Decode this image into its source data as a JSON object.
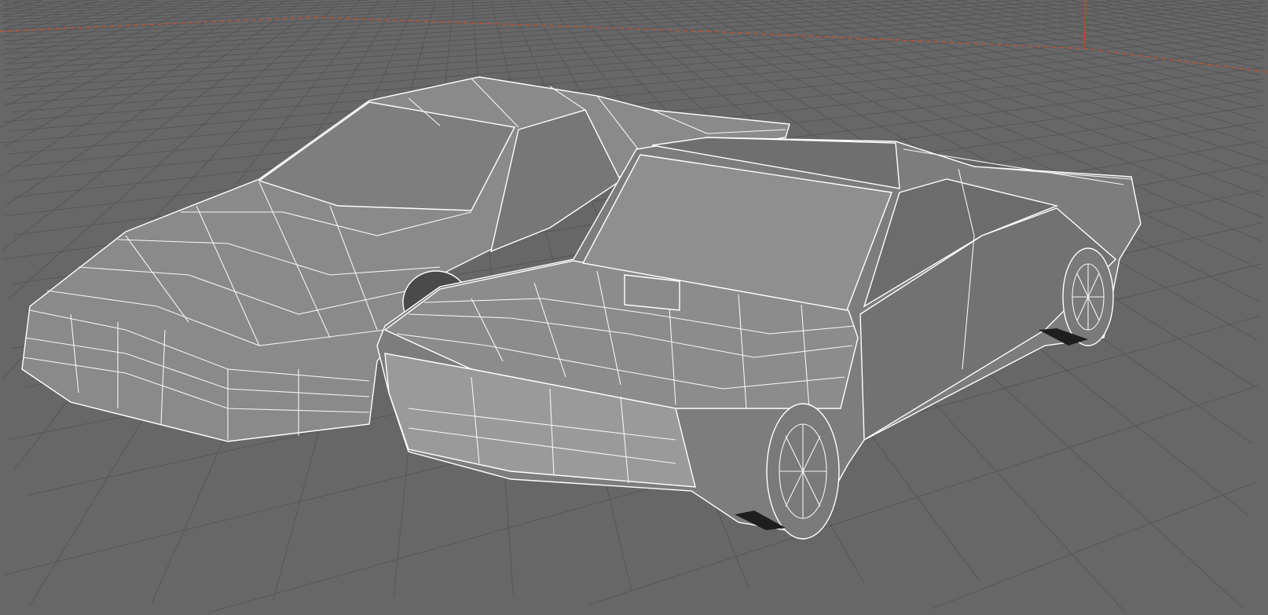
{
  "viewport": {
    "background_color": "#676767",
    "grid_color": "#565656",
    "axis_x_color": "#b0563a",
    "axis_y_color": "#c0462a",
    "wire_color": "#ffffff"
  },
  "models": [
    {
      "name": "sports-car",
      "shading": "wireframe-on-shaded"
    },
    {
      "name": "sedan-car",
      "shading": "wireframe-on-shaded"
    }
  ]
}
